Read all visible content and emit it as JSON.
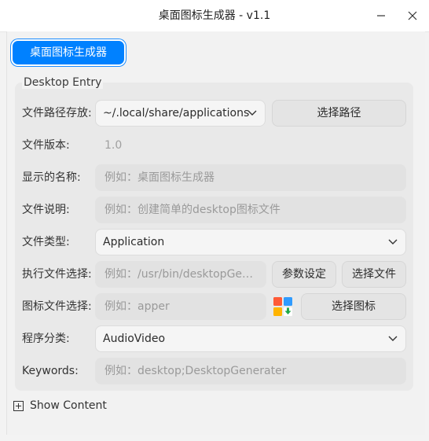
{
  "window": {
    "title": "桌面图标生成器 - v1.1"
  },
  "app_button": {
    "label": "桌面图标生成器"
  },
  "group": {
    "title": "Desktop Entry"
  },
  "path_row": {
    "label": "文件路径存放:",
    "selected": "~/.local/share/applications",
    "button": "选择路径"
  },
  "version_row": {
    "label": "文件版本:",
    "value": "1.0"
  },
  "name_row": {
    "label": "显示的名称:",
    "placeholder": "例如：桌面图标生成器"
  },
  "comment_row": {
    "label": "文件说明:",
    "placeholder": "例如：创建简单的desktop图标文件"
  },
  "type_row": {
    "label": "文件类型:",
    "selected": "Application"
  },
  "exec_row": {
    "label": "执行文件选择:",
    "placeholder": "例如：/usr/bin/desktopGen…",
    "params_button": "参数设定",
    "select_button": "选择文件"
  },
  "icon_row": {
    "label": "图标文件选择:",
    "placeholder": "例如：apper",
    "button": "选择图标"
  },
  "category_row": {
    "label": "程序分类:",
    "selected": "AudioVideo"
  },
  "keywords_row": {
    "label": "Keywords:",
    "placeholder": "例如：desktop;DesktopGenerater"
  },
  "footer": {
    "show_content": "Show Content"
  },
  "colors": {
    "accent": "#0081ff",
    "background": "#f3f3f3",
    "group": "#e9e9e9"
  }
}
